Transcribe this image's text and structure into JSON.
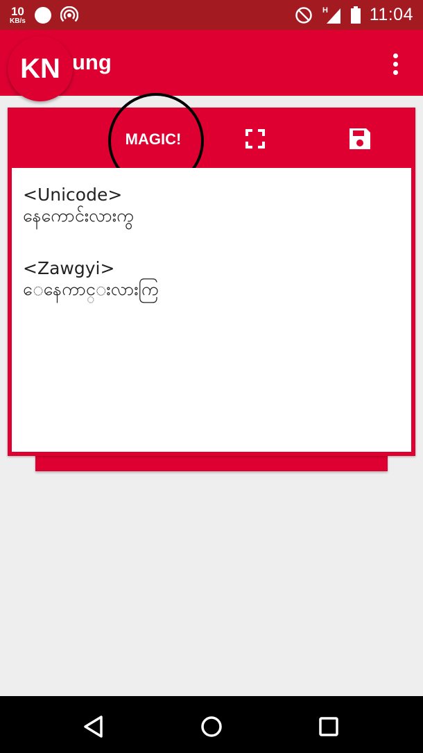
{
  "status_bar": {
    "speed_value": "10",
    "speed_unit": "KB/s",
    "network_type": "H",
    "time": "11:04",
    "icons": [
      "circle-notification-icon",
      "hotspot-icon",
      "do-not-disturb-icon",
      "signal-icon",
      "battery-icon"
    ]
  },
  "app_bar": {
    "logo_text": "KN",
    "title": "ung",
    "menu_icon": "more-vert-icon"
  },
  "card": {
    "magic_label": "MAGIC!",
    "fullscreen_icon": "fullscreen-icon",
    "save_icon": "save-icon",
    "editor": {
      "unicode_header": "<Unicode>",
      "unicode_text": "နေကောင်းလားကွ",
      "zawgyi_header": "<Zawgyi>",
      "zawgyi_text": "ေနေကာင္းလားကြ"
    }
  },
  "nav_bar": {
    "icons": [
      "back-icon",
      "home-icon",
      "recents-icon"
    ]
  },
  "colors": {
    "status_bar": "#a31b20",
    "accent": "#dd0031",
    "background": "#eeeeee"
  }
}
